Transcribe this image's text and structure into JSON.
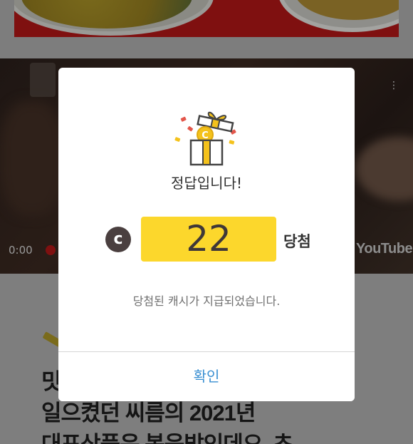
{
  "background": {
    "video": {
      "timecode": "0:00",
      "brand": "YouTube",
      "menu_glyph": "⋮"
    },
    "article": {
      "headline_lines": [
        "밋",
        "일으켰던 씨름의 2021년",
        "대표상품은 복음밥인데요. 초"
      ]
    }
  },
  "modal": {
    "icons": {
      "gift": "gift-box-icon",
      "coin": "cash-coin-icon"
    },
    "coin_glyph": "c",
    "gift_coin_glyph": "C",
    "title": "정답입니다!",
    "amount": "22",
    "amount_suffix": "당첨",
    "message": "당첨된 캐시가 지급되었습니다.",
    "confirm_label": "확인"
  },
  "colors": {
    "accent_yellow": "#fcd72c",
    "coin_brown": "#4a3f3f",
    "confirm_blue": "#3a8fd2",
    "overlay_dim": "#7a7a7a"
  }
}
